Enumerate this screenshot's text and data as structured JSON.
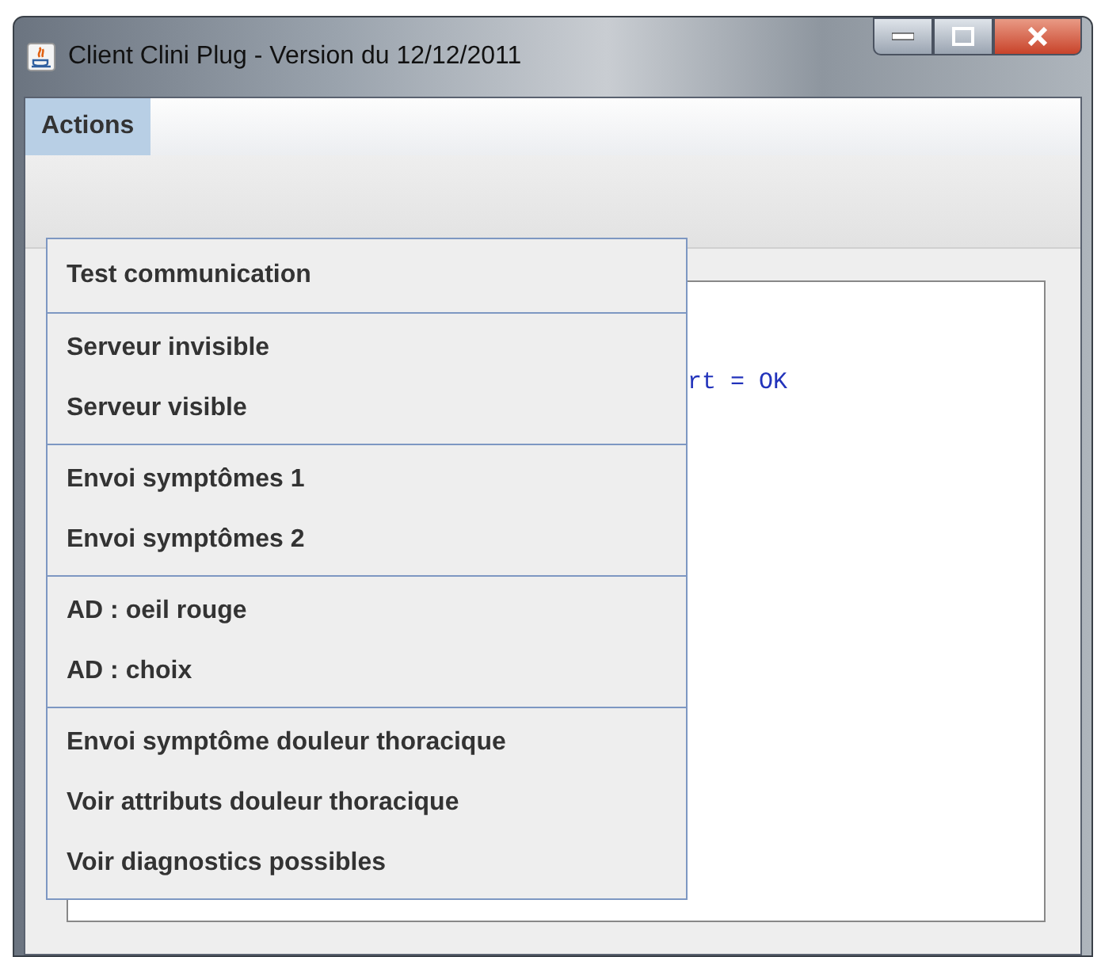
{
  "window": {
    "title": "Client Clini Plug - Version du 12/12/2011"
  },
  "menubar": [
    {
      "label": "Actions",
      "selected": true
    }
  ],
  "menu_groups": [
    [
      "Test communication"
    ],
    [
      "Serveur invisible",
      "Serveur visible"
    ],
    [
      "Envoi symptômes 1",
      "Envoi symptômes 2"
    ],
    [
      "AD : oeil rouge",
      "AD : choix"
    ],
    [
      "Envoi symptôme douleur thoracique",
      "Voir attributs douleur thoracique",
      "Voir diagnostics possibles"
    ]
  ],
  "output": {
    "text": "rt = OK"
  }
}
